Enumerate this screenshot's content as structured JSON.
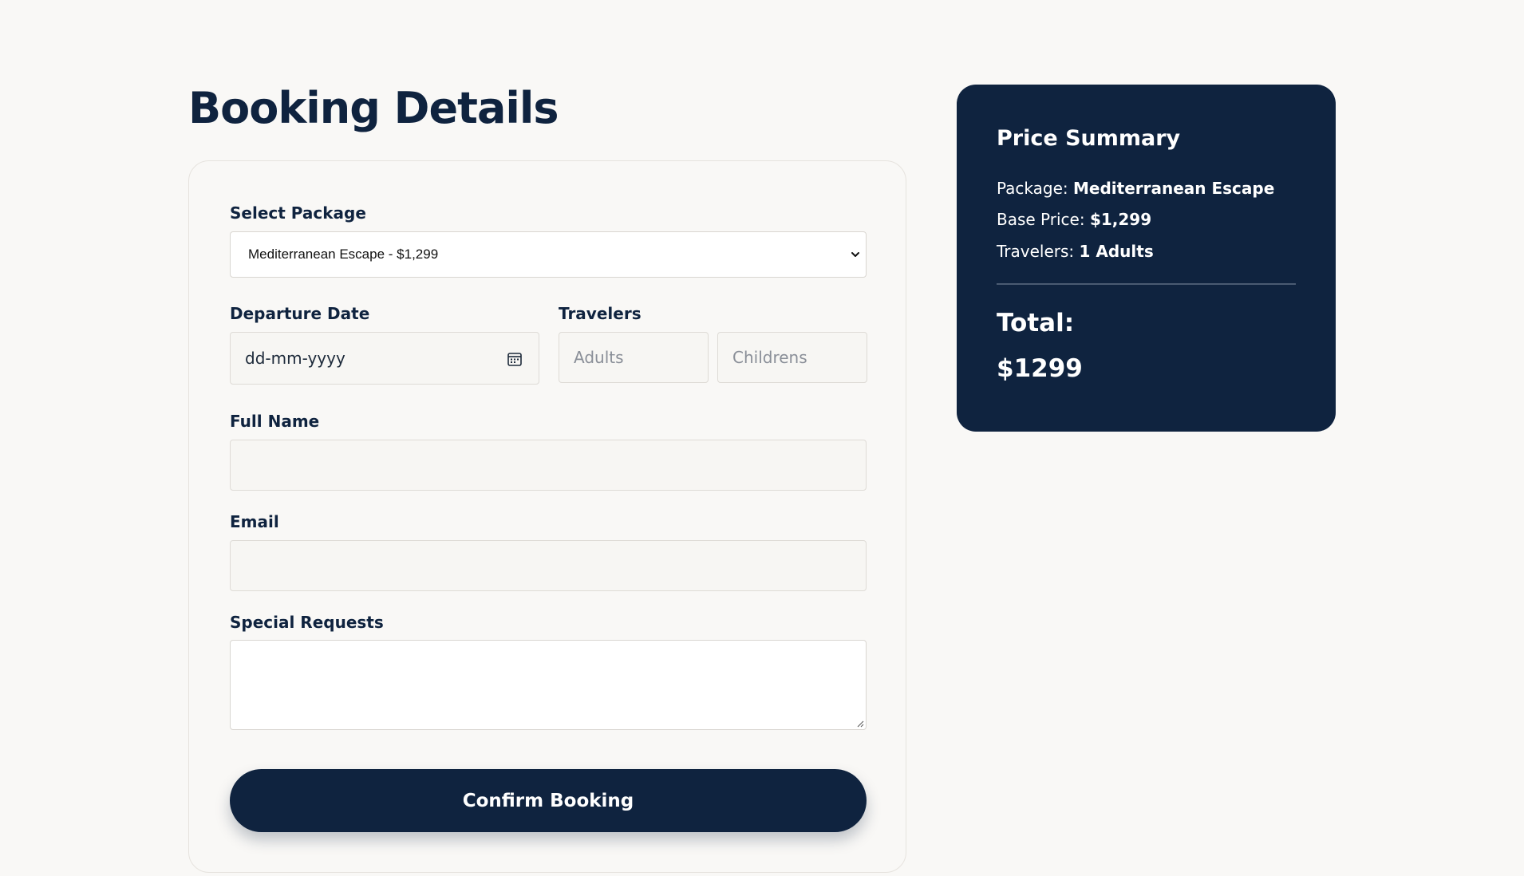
{
  "page": {
    "title": "Booking Details"
  },
  "form": {
    "package_label": "Select Package",
    "package_selected": "Mediterranean Escape - $1,299",
    "departure_label": "Departure Date",
    "departure_placeholder": "dd-mm-yyyy",
    "travelers_label": "Travelers",
    "adults_placeholder": "Adults",
    "children_placeholder": "Childrens",
    "fullname_label": "Full Name",
    "fullname_value": "",
    "email_label": "Email",
    "email_value": "",
    "requests_label": "Special Requests",
    "requests_value": "",
    "confirm_label": "Confirm Booking"
  },
  "summary": {
    "title": "Price Summary",
    "package_prefix": "Package:",
    "package_value": "Mediterranean Escape",
    "base_prefix": "Base Price:",
    "base_value": "$1,299",
    "travelers_prefix": "Travelers:",
    "travelers_value": "1 Adults",
    "total_label": "Total:",
    "total_value": "$1299"
  },
  "icons": {
    "select_chevron": "chevron-down-icon",
    "date_picker": "calendar-icon",
    "textarea_resize": "resize-handle-icon"
  },
  "colors": {
    "background": "#f9f8f6",
    "navy": "#0f233f",
    "input_bg": "#f7f6f3",
    "white": "#ffffff"
  }
}
